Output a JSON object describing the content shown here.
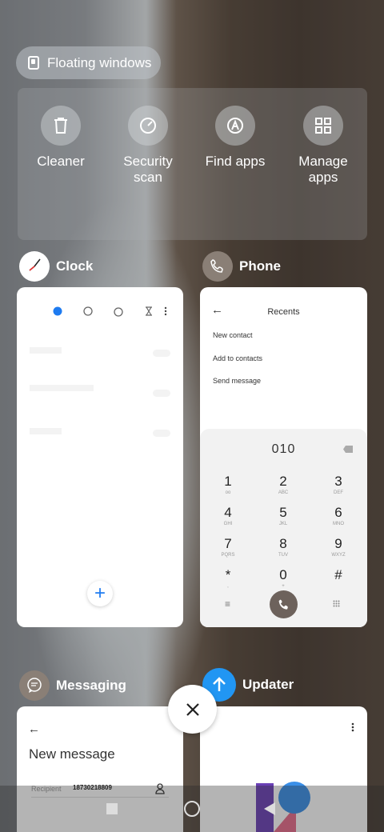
{
  "floating": {
    "label": "Floating windows"
  },
  "quick_actions": [
    {
      "label": "Cleaner",
      "icon": "trash-icon"
    },
    {
      "label": "Security\nscan",
      "icon": "security-scan-icon"
    },
    {
      "label": "Find apps",
      "icon": "find-apps-icon"
    },
    {
      "label": "Manage\napps",
      "icon": "grid-icon"
    }
  ],
  "apps": {
    "clock": {
      "name": "Clock",
      "add_symbol": "+"
    },
    "phone": {
      "name": "Phone",
      "title": "Recents",
      "menu": [
        "New contact",
        "Add to contacts",
        "Send message"
      ],
      "dial_number": "010",
      "keys": [
        {
          "n": "1",
          "l": "oo"
        },
        {
          "n": "2",
          "l": "ABC"
        },
        {
          "n": "3",
          "l": "DEF"
        },
        {
          "n": "4",
          "l": "GHI"
        },
        {
          "n": "5",
          "l": "JKL"
        },
        {
          "n": "6",
          "l": "MNO"
        },
        {
          "n": "7",
          "l": "PQRS"
        },
        {
          "n": "8",
          "l": "TUV"
        },
        {
          "n": "9",
          "l": "WXYZ"
        },
        {
          "n": "*",
          "l": ","
        },
        {
          "n": "0",
          "l": "+"
        },
        {
          "n": "#",
          "l": ""
        }
      ]
    },
    "messaging": {
      "name": "Messaging",
      "title": "New message",
      "recipient_label": "Recipient",
      "recipient_value": "18730218809"
    },
    "updater": {
      "name": "Updater"
    }
  },
  "colors": {
    "accent_blue": "#1e7bf0",
    "updater_blue": "#2196f3",
    "call_button": "#6d625c"
  }
}
